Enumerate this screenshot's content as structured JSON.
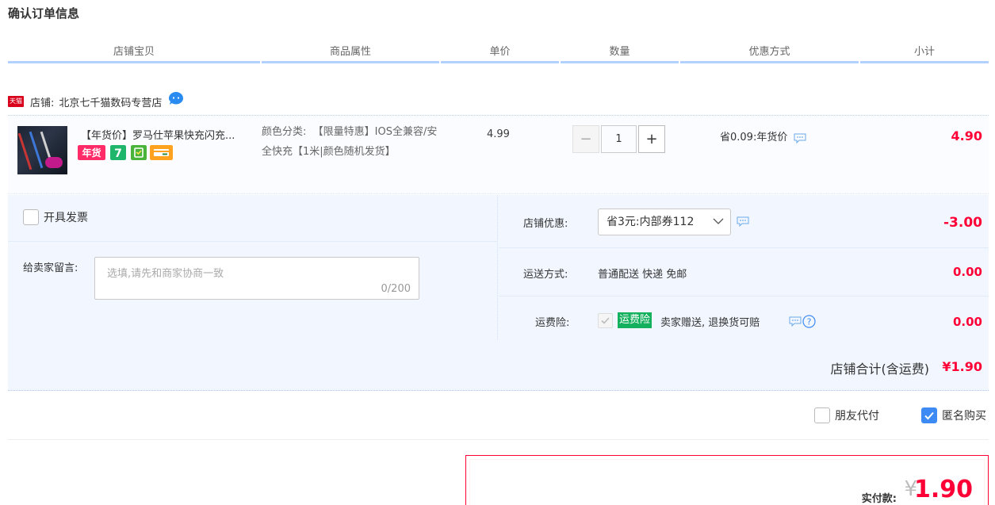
{
  "page_title": "确认订单信息",
  "columns": [
    "店铺宝贝",
    "商品属性",
    "单价",
    "数量",
    "优惠方式",
    "小计"
  ],
  "shop": {
    "badge": "天猫",
    "label": "店铺:",
    "name": "北京七千猫数码专营店",
    "chat_icon": "wangwang-chat-icon"
  },
  "item": {
    "title": "【年货价】罗马仕苹果快充闪充...",
    "attr_label": "颜色分类:",
    "attr_value": "【限量特惠】IOS全兼容/安全快充【1米|颜色随机发货】",
    "unit_price": "4.99",
    "qty_minus": "−",
    "qty": "1",
    "qty_plus": "+",
    "promo": "省0.09:年货价",
    "subtotal": "4.90",
    "badge_icons": [
      "new-year-goods-icon",
      "seven-day-return-icon",
      "tmall-guarantee-icon",
      "card-pay-icon"
    ]
  },
  "extras": {
    "invoice_label": "开具发票",
    "message_label": "给卖家留言:",
    "message_placeholder": "选填,请先和商家协商一致",
    "message_count": "0/200"
  },
  "shop_discount": {
    "label": "店铺优惠:",
    "selected": "省3元:内部券112",
    "value": "-3.00"
  },
  "shipping": {
    "label": "运送方式:",
    "method": "普通配送 快递 免邮",
    "value": "0.00"
  },
  "insurance": {
    "label": "运费险:",
    "tag": "运费险",
    "text": "卖家赠送, 退换货可赔",
    "value": "0.00"
  },
  "shop_total": {
    "label": "店铺合计(含运费)",
    "value": "¥1.90"
  },
  "options": {
    "friend_pay": "朋友代付",
    "anonymous": "匿名购买"
  },
  "payment": {
    "label": "实付款:",
    "currency": "¥",
    "amount": "1.90"
  },
  "colors": {
    "accent_red": "#ff0036",
    "header_bar": "#b2d1ff",
    "panel_bg": "#f2f7ff",
    "checkbox_blue": "#3d8af5",
    "insurance_green": "#13b05d"
  }
}
